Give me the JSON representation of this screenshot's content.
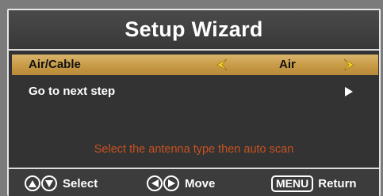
{
  "title": "Setup Wizard",
  "rows": [
    {
      "label": "Air/Cable",
      "value": "Air",
      "selected": true
    },
    {
      "label": "Go to next step",
      "selected": false
    }
  ],
  "hint": "Select the antenna type then auto scan",
  "footer": {
    "select_label": "Select",
    "move_label": "Move",
    "menu_key": "MENU",
    "return_label": "Return"
  },
  "colors": {
    "highlight": "#c79a45",
    "hint": "#c8511f",
    "panel": "#333333",
    "title_bar": "#404040"
  },
  "icons": [
    "up-icon",
    "down-icon",
    "left-icon",
    "right-icon",
    "arrow-left-icon",
    "arrow-right-icon",
    "next-arrow-icon"
  ]
}
